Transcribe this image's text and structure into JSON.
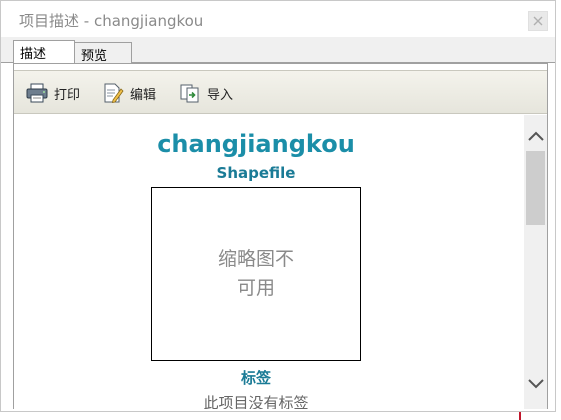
{
  "window": {
    "title": "项目描述 - changjiangkou",
    "close_label": "×"
  },
  "tabs": [
    {
      "label": "描述",
      "active": true
    },
    {
      "label": "预览",
      "active": false
    }
  ],
  "toolbar": {
    "print_label": "打印",
    "edit_label": "编辑",
    "import_label": "导入"
  },
  "content": {
    "item_name": "changjiangkou",
    "item_type": "Shapefile",
    "thumbnail_text": "缩略图不可用",
    "tags_heading": "标签",
    "tags_text": "此项目没有标签"
  },
  "colors": {
    "title_accent": "#1b8ea8",
    "heading_accent": "#1a7b96"
  }
}
